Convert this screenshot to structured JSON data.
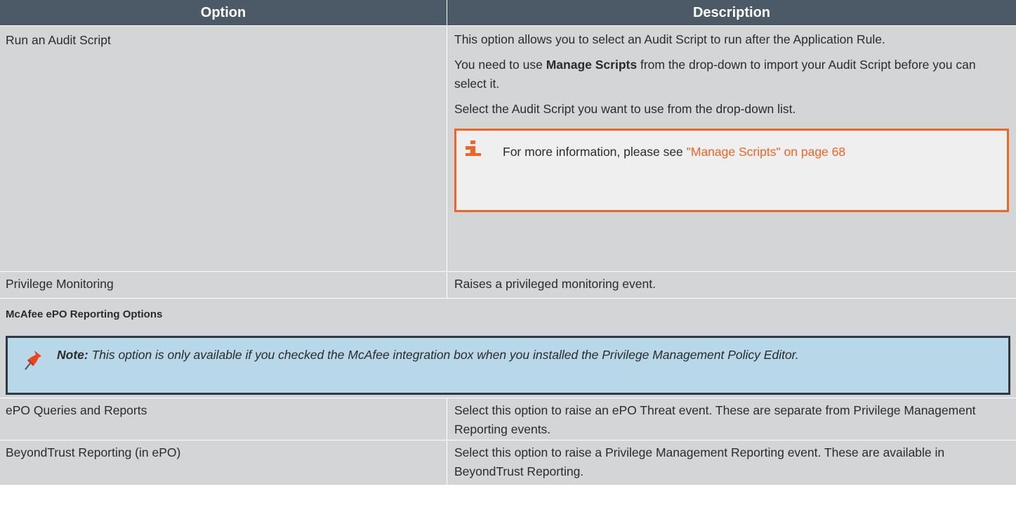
{
  "table": {
    "headers": {
      "option": "Option",
      "description": "Description"
    },
    "rows": [
      {
        "option": "Run an Audit Script",
        "desc_p1": "This option allows you to select an Audit Script to run after the Application Rule.",
        "desc_p2_pre": "You need to use ",
        "desc_p2_bold": "Manage Scripts",
        "desc_p2_post": " from the drop-down to import your Audit Script before you can select it.",
        "desc_p3": "Select the Audit Script you want to use from the drop-down list.",
        "callout": {
          "icon": "info-icon",
          "text_pre": "For more information, please see ",
          "link": "\"Manage Scripts\" on page 68"
        }
      },
      {
        "option": "Privilege Monitoring",
        "description": "Raises a privileged monitoring event."
      },
      {
        "option": "ePO Queries and Reports",
        "description": "Select this option to raise an ePO Threat event. These are separate from Privilege Management Reporting events."
      },
      {
        "option": "BeyondTrust Reporting (in ePO)",
        "description": "Select this option to raise a Privilege Management Reporting event. These are available in BeyondTrust Reporting."
      }
    ],
    "section": {
      "title": "McAfee ePO Reporting Options",
      "note_icon": "pushpin-icon",
      "note_label": "Note:",
      "note_text": " This option is only available if you checked the McAfee integration box when you installed the Privilege Management Policy Editor."
    }
  },
  "colors": {
    "header_bg": "#4b5a66",
    "row_bg": "#d3d5d6",
    "callout_border": "#f26522",
    "note_bg": "#b8d7e8",
    "note_border": "#2f3a44"
  }
}
